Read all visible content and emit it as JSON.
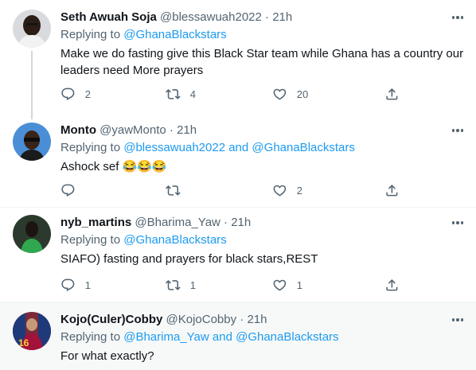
{
  "tweets": [
    {
      "name": "Seth Awuah Soja",
      "handle": "@blessawuah2022",
      "dot": "·",
      "time": "21h",
      "replying_prefix": "Replying to ",
      "replying_to": "@GhanaBlackstars",
      "replying_and": "",
      "replying_to_2": "",
      "text": "Make we do fasting give this Black Star team while Ghana has a country our leaders need More prayers",
      "replies": "2",
      "retweets": "4",
      "likes": "20"
    },
    {
      "name": "Monto",
      "handle": "@yawMonto",
      "dot": "·",
      "time": "21h",
      "replying_prefix": "Replying to ",
      "replying_to": "@blessawuah2022",
      "replying_and": " and ",
      "replying_to_2": "@GhanaBlackstars",
      "text": "Ashock sef 😂😂😂",
      "replies": "",
      "retweets": "",
      "likes": "2"
    },
    {
      "name": "nyb_martins",
      "handle": "@Bharima_Yaw",
      "dot": "·",
      "time": "21h",
      "replying_prefix": "Replying to ",
      "replying_to": "@GhanaBlackstars",
      "replying_and": "",
      "replying_to_2": "",
      "text": "SIAFO) fasting and prayers for black stars,REST",
      "replies": "1",
      "retweets": "1",
      "likes": "1"
    },
    {
      "name": "Kojo(Culer)Cobby",
      "handle": "@KojoCobby",
      "dot": "·",
      "time": "21h",
      "replying_prefix": "Replying to ",
      "replying_to": "@Bharima_Yaw",
      "replying_and": " and ",
      "replying_to_2": "@GhanaBlackstars",
      "text": "For what exactly?"
    }
  ],
  "colors": {
    "text": "#0f1419",
    "secondary": "#536471",
    "link": "#1d9bf0",
    "divider": "#eff3f4",
    "hover": "#f7f9f9"
  },
  "icons": [
    "reply-icon",
    "retweet-icon",
    "like-icon",
    "share-icon",
    "more-icon"
  ]
}
